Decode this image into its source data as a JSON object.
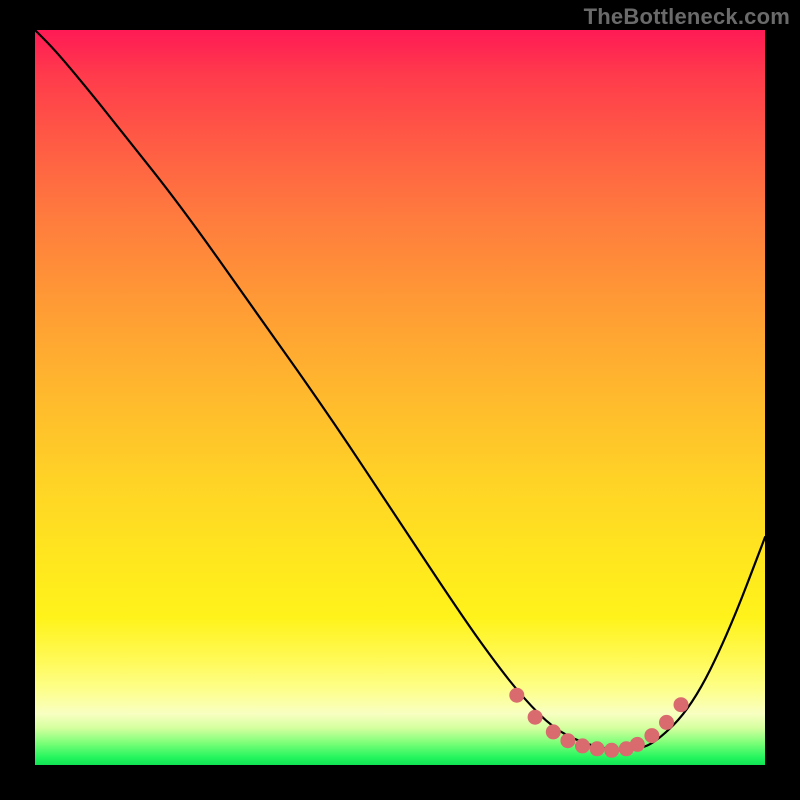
{
  "watermark": "TheBottleneck.com",
  "chart_data": {
    "type": "line",
    "title": "",
    "xlabel": "",
    "ylabel": "",
    "legend": false,
    "grid": false,
    "background": "rainbow-gradient-red-to-green",
    "x_range": [
      0,
      1
    ],
    "y_range": [
      0,
      1
    ],
    "series": [
      {
        "name": "bottleneck-curve",
        "color": "#000000",
        "x": [
          0.0,
          0.03,
          0.08,
          0.12,
          0.2,
          0.3,
          0.4,
          0.5,
          0.58,
          0.63,
          0.67,
          0.71,
          0.75,
          0.79,
          0.82,
          0.85,
          0.9,
          0.95,
          1.0
        ],
        "y": [
          1.0,
          0.97,
          0.91,
          0.86,
          0.76,
          0.62,
          0.48,
          0.33,
          0.21,
          0.14,
          0.09,
          0.05,
          0.03,
          0.02,
          0.02,
          0.03,
          0.08,
          0.18,
          0.31
        ]
      }
    ],
    "highlight_points": {
      "name": "optimal-range-dots",
      "color": "#d96a6e",
      "x": [
        0.66,
        0.685,
        0.71,
        0.73,
        0.75,
        0.77,
        0.79,
        0.81,
        0.825,
        0.845,
        0.865,
        0.885
      ],
      "y": [
        0.095,
        0.065,
        0.045,
        0.033,
        0.026,
        0.022,
        0.02,
        0.022,
        0.028,
        0.04,
        0.058,
        0.082
      ]
    }
  }
}
